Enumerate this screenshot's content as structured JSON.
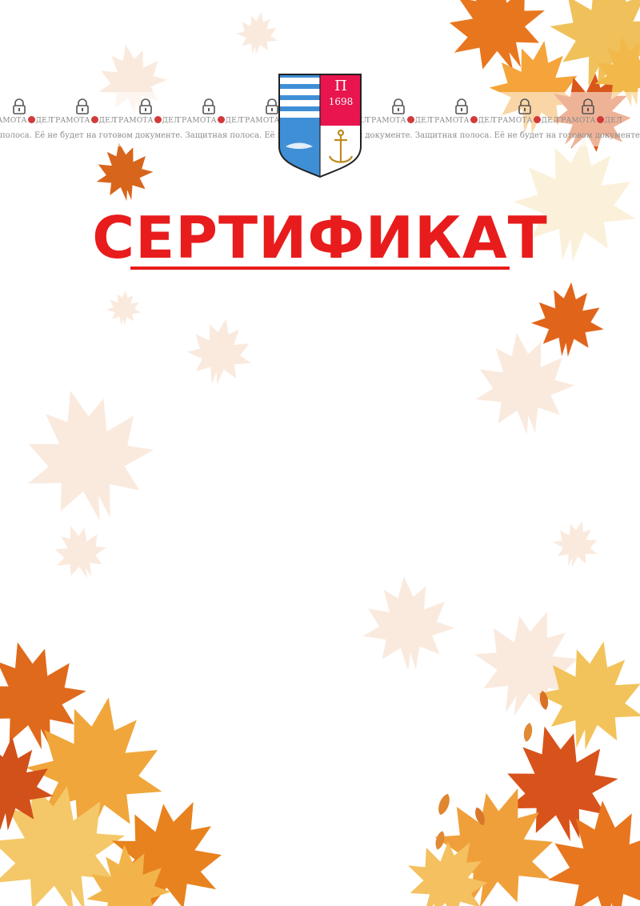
{
  "certificate": {
    "title": "СЕРТИФИКАТ"
  },
  "coat_of_arms": {
    "year": "1698",
    "letter": "П"
  },
  "watermark": {
    "brand_left": "ГРАМОТА",
    "brand_right": "ДЕЛ",
    "notice": "Защитная полоса. Её не будет на готовом документе.",
    "notice_lead": "полоса. Её не будет на готовом документе."
  },
  "colors": {
    "title_red": "#e81c1c",
    "leaf_orange": "#e8761e",
    "leaf_yellow": "#f4b23a",
    "crest_blue": "#3f8fd6",
    "crest_pink": "#e8154f"
  }
}
